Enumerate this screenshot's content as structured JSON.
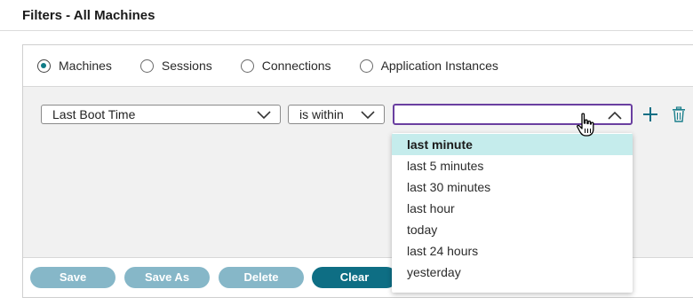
{
  "page": {
    "title": "Filters - All Machines"
  },
  "radio_group": {
    "options": [
      {
        "label": "Machines",
        "checked": true
      },
      {
        "label": "Sessions",
        "checked": false
      },
      {
        "label": "Connections",
        "checked": false
      },
      {
        "label": "Application Instances",
        "checked": false
      }
    ]
  },
  "filter_row": {
    "field": "Last Boot Time",
    "operator": "is within",
    "value": ""
  },
  "dropdown": {
    "options": [
      "last minute",
      "last 5 minutes",
      "last 30 minutes",
      "last hour",
      "today",
      "last 24 hours",
      "yesterday"
    ],
    "highlighted": "last minute"
  },
  "buttons": {
    "save": "Save",
    "save_as": "Save As",
    "delete": "Delete",
    "clear": "Clear"
  },
  "colors": {
    "accent": "#0e6e84",
    "radio_dot": "#0f7b86",
    "active_border": "#6a3fa0",
    "highlight_bg": "#c5ecec",
    "disabled_button": "#86b7c8"
  },
  "icons": [
    "plus-icon",
    "trash-icon",
    "chevron-down-icon",
    "chevron-up-icon",
    "hand-cursor-icon"
  ]
}
